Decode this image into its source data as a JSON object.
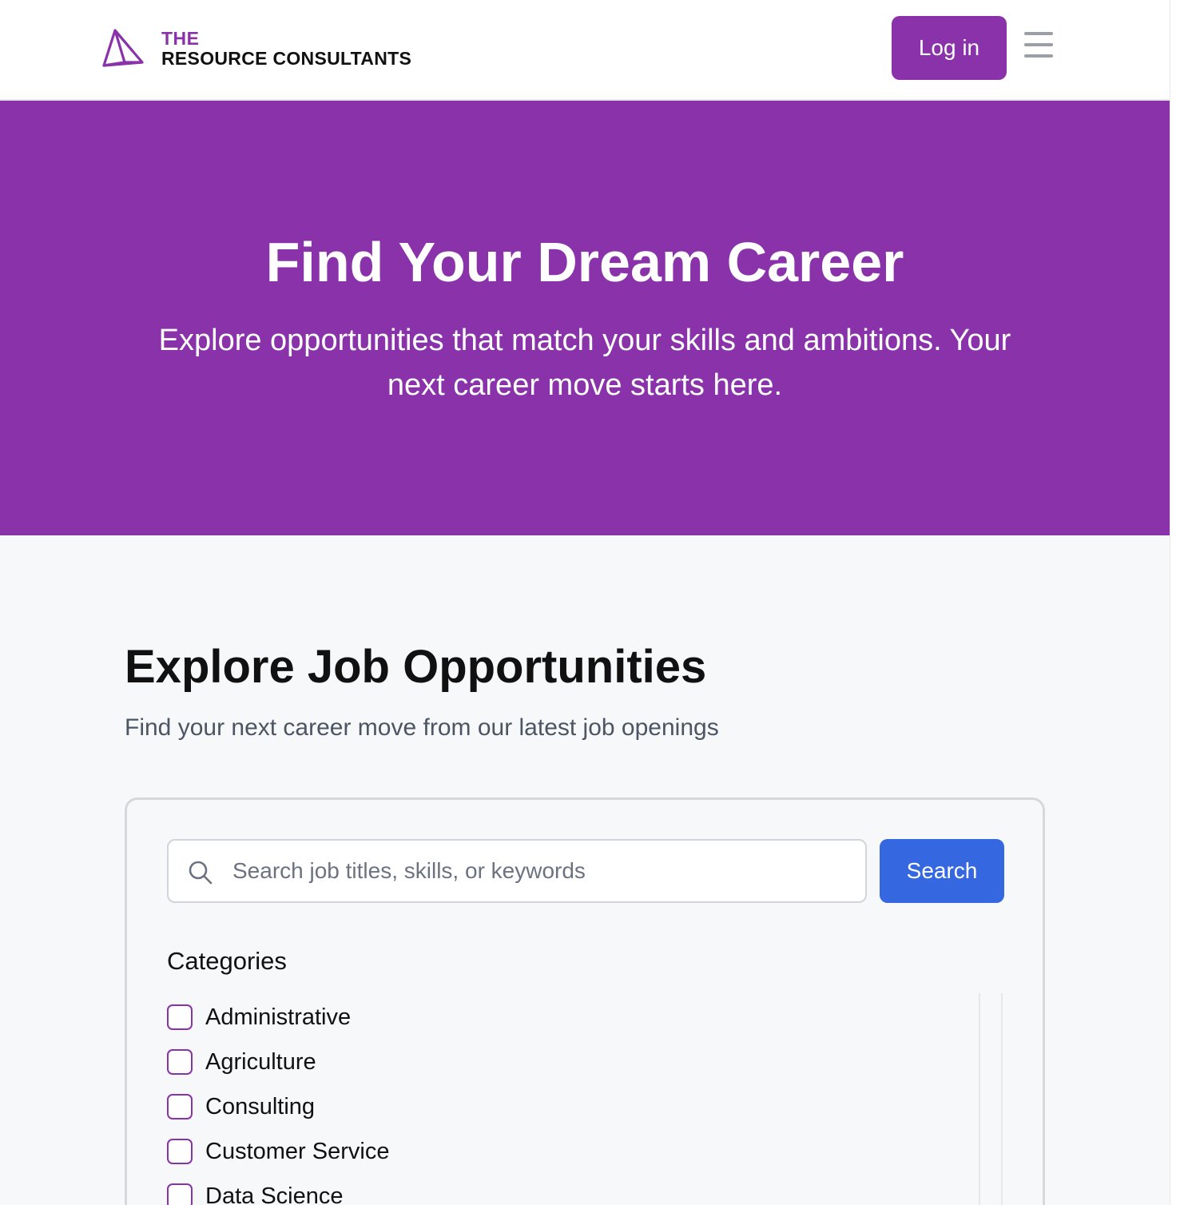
{
  "colors": {
    "brand_purple": "#8a32a9",
    "search_blue": "#3567e0"
  },
  "header": {
    "logo_line1": "THE",
    "logo_line2": "RESOURCE CONSULTANTS",
    "login_label": "Log in",
    "logo_icon": "prism-icon",
    "menu_icon": "hamburger-menu-icon"
  },
  "hero": {
    "title": "Find Your Dream Career",
    "subtitle": "Explore opportunities that match your skills and ambitions. Your next career move starts here."
  },
  "jobs": {
    "title": "Explore Job Opportunities",
    "subtitle": "Find your next career move from our latest job openings",
    "search_placeholder": "Search job titles, skills, or keywords",
    "search_label": "Search",
    "categories_title": "Categories",
    "categories": [
      {
        "label": "Administrative",
        "checked": false
      },
      {
        "label": "Agriculture",
        "checked": false
      },
      {
        "label": "Consulting",
        "checked": false
      },
      {
        "label": "Customer Service",
        "checked": false
      },
      {
        "label": "Data Science",
        "checked": false
      }
    ]
  }
}
